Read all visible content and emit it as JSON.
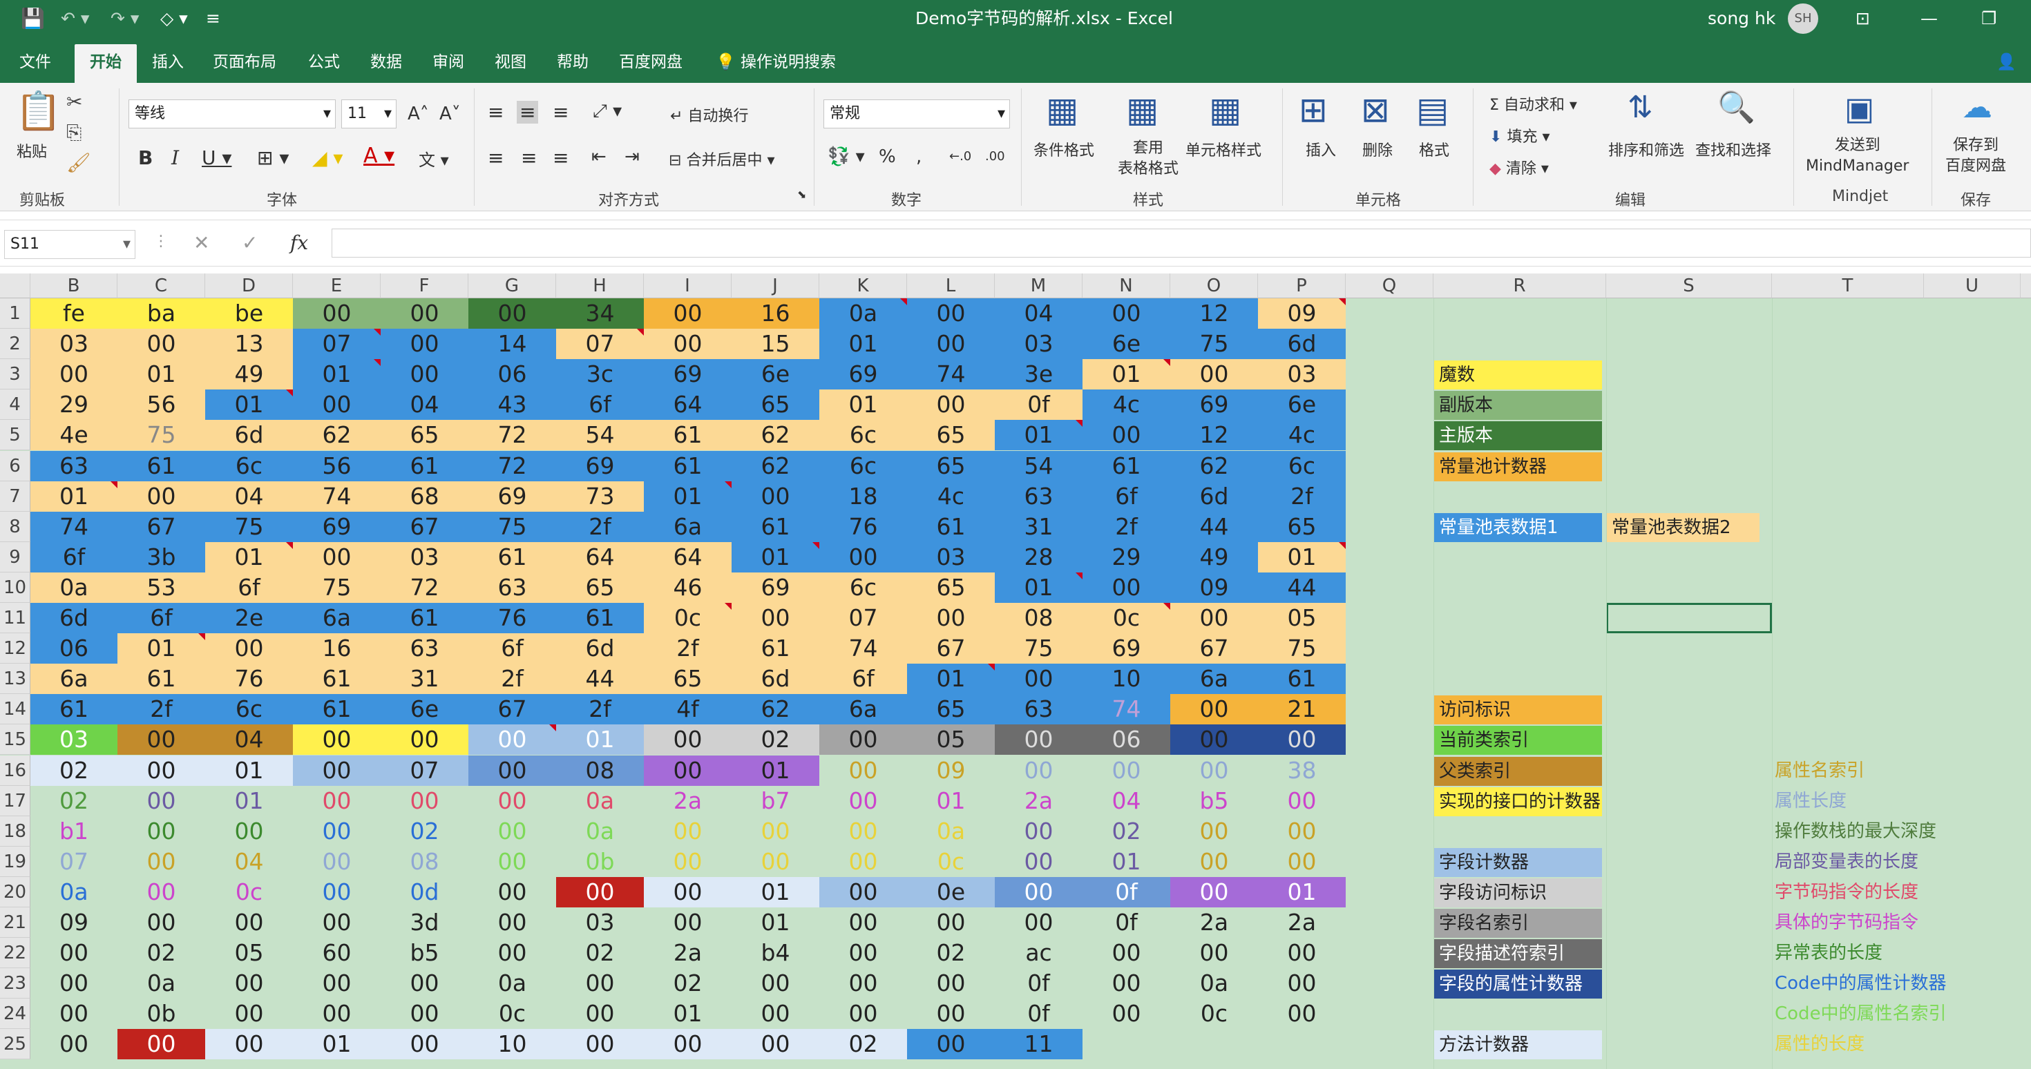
{
  "window": {
    "title": "Demo字节码的解析.xlsx  -  Excel",
    "user": "song hk",
    "user_initials": "SH"
  },
  "tabs": [
    "文件",
    "开始",
    "插入",
    "页面布局",
    "公式",
    "数据",
    "审阅",
    "视图",
    "帮助",
    "百度网盘",
    "操作说明搜索"
  ],
  "ribbon": {
    "paste": "粘贴",
    "clipboard": "剪贴板",
    "font_name": "等线",
    "font_size": "11",
    "font_group": "字体",
    "wrap": "自动换行",
    "merge": "合并后居中",
    "align_group": "对齐方式",
    "number_format": "常规",
    "number_group": "数字",
    "cond_format": "条件格式",
    "table_format": "套用\n表格格式",
    "cell_style": "单元格样式",
    "styles_group": "样式",
    "insert": "插入",
    "delete": "删除",
    "format": "格式",
    "cells_group": "单元格",
    "autosum": "自动求和",
    "fill": "填充",
    "clear": "清除",
    "sort": "排序和筛选",
    "find": "查找和选择",
    "edit_group": "编辑",
    "mindmanager": "发送到\nMindManager",
    "mindjet": "Mindjet",
    "baidu_save": "保存到\n百度网盘",
    "save_group": "保存"
  },
  "formula_bar": {
    "name_box": "S11",
    "fx": "fx",
    "content": ""
  },
  "columns": [
    "B",
    "C",
    "D",
    "E",
    "F",
    "G",
    "H",
    "I",
    "J",
    "K",
    "L",
    "M",
    "N",
    "O",
    "P",
    "Q",
    "R",
    "S",
    "T",
    "U",
    "V"
  ],
  "rows": [
    "1",
    "2",
    "3",
    "4",
    "5",
    "6",
    "7",
    "8",
    "9",
    "10",
    "11",
    "12",
    "13",
    "14",
    "15",
    "16",
    "17",
    "18",
    "19",
    "20",
    "21",
    "22",
    "23",
    "24",
    "25"
  ],
  "cells": [
    [
      "fe",
      "ba",
      "be",
      "00",
      "00",
      "00",
      "34",
      "00",
      "16",
      "0a",
      "00",
      "04",
      "00",
      "12",
      "09"
    ],
    [
      "03",
      "00",
      "13",
      "07",
      "00",
      "14",
      "07",
      "00",
      "15",
      "01",
      "00",
      "03",
      "6e",
      "75",
      "6d"
    ],
    [
      "00",
      "01",
      "49",
      "01",
      "00",
      "06",
      "3c",
      "69",
      "6e",
      "69",
      "74",
      "3e",
      "01",
      "00",
      "03"
    ],
    [
      "29",
      "56",
      "01",
      "00",
      "04",
      "43",
      "6f",
      "64",
      "65",
      "01",
      "00",
      "0f",
      "4c",
      "69",
      "6e"
    ],
    [
      "4e",
      "75",
      "6d",
      "62",
      "65",
      "72",
      "54",
      "61",
      "62",
      "6c",
      "65",
      "01",
      "00",
      "12",
      "4c"
    ],
    [
      "63",
      "61",
      "6c",
      "56",
      "61",
      "72",
      "69",
      "61",
      "62",
      "6c",
      "65",
      "54",
      "61",
      "62",
      "6c"
    ],
    [
      "01",
      "00",
      "04",
      "74",
      "68",
      "69",
      "73",
      "01",
      "00",
      "18",
      "4c",
      "63",
      "6f",
      "6d",
      "2f"
    ],
    [
      "74",
      "67",
      "75",
      "69",
      "67",
      "75",
      "2f",
      "6a",
      "61",
      "76",
      "61",
      "31",
      "2f",
      "44",
      "65"
    ],
    [
      "6f",
      "3b",
      "01",
      "00",
      "03",
      "61",
      "64",
      "64",
      "01",
      "00",
      "03",
      "28",
      "29",
      "49",
      "01"
    ],
    [
      "0a",
      "53",
      "6f",
      "75",
      "72",
      "63",
      "65",
      "46",
      "69",
      "6c",
      "65",
      "01",
      "00",
      "09",
      "44"
    ],
    [
      "6d",
      "6f",
      "2e",
      "6a",
      "61",
      "76",
      "61",
      "0c",
      "00",
      "07",
      "00",
      "08",
      "0c",
      "00",
      "05"
    ],
    [
      "06",
      "01",
      "00",
      "16",
      "63",
      "6f",
      "6d",
      "2f",
      "61",
      "74",
      "67",
      "75",
      "69",
      "67",
      "75"
    ],
    [
      "6a",
      "61",
      "76",
      "61",
      "31",
      "2f",
      "44",
      "65",
      "6d",
      "6f",
      "01",
      "00",
      "10",
      "6a",
      "61"
    ],
    [
      "61",
      "2f",
      "6c",
      "61",
      "6e",
      "67",
      "2f",
      "4f",
      "62",
      "6a",
      "65",
      "63",
      "74",
      "00",
      "21"
    ],
    [
      "03",
      "00",
      "04",
      "00",
      "00",
      "00",
      "01",
      "00",
      "02",
      "00",
      "05",
      "00",
      "06",
      "00",
      "00"
    ],
    [
      "02",
      "00",
      "01",
      "00",
      "07",
      "00",
      "08",
      "00",
      "01",
      "00",
      "09",
      "00",
      "00",
      "00",
      "38"
    ],
    [
      "02",
      "00",
      "01",
      "00",
      "00",
      "00",
      "0a",
      "2a",
      "b7",
      "00",
      "01",
      "2a",
      "04",
      "b5",
      "00"
    ],
    [
      "b1",
      "00",
      "00",
      "00",
      "02",
      "00",
      "0a",
      "00",
      "00",
      "00",
      "0a",
      "00",
      "02",
      "00",
      "00"
    ],
    [
      "07",
      "00",
      "04",
      "00",
      "08",
      "00",
      "0b",
      "00",
      "00",
      "00",
      "0c",
      "00",
      "01",
      "00",
      "00"
    ],
    [
      "0a",
      "00",
      "0c",
      "00",
      "0d",
      "00",
      "00",
      "00",
      "01",
      "00",
      "0e",
      "00",
      "0f",
      "00",
      "01"
    ],
    [
      "09",
      "00",
      "00",
      "00",
      "3d",
      "00",
      "03",
      "00",
      "01",
      "00",
      "00",
      "00",
      "0f",
      "2a",
      "2a"
    ],
    [
      "00",
      "02",
      "05",
      "60",
      "b5",
      "00",
      "02",
      "2a",
      "b4",
      "00",
      "02",
      "ac",
      "00",
      "00",
      "00"
    ],
    [
      "00",
      "0a",
      "00",
      "00",
      "00",
      "0a",
      "00",
      "02",
      "00",
      "00",
      "00",
      "0f",
      "00",
      "0a",
      "00"
    ],
    [
      "00",
      "0b",
      "00",
      "00",
      "00",
      "0c",
      "00",
      "01",
      "00",
      "00",
      "00",
      "0f",
      "00",
      "0c",
      "00"
    ],
    [
      "00",
      "00",
      "00",
      "01",
      "00",
      "10",
      "00",
      "00",
      "00",
      "02",
      "00",
      "11",
      "",
      "",
      ""
    ]
  ],
  "legend_r": [
    {
      "row": 3,
      "text": "魔数",
      "bg": "#fff04d"
    },
    {
      "row": 4,
      "text": "副版本",
      "bg": "#87b67a"
    },
    {
      "row": 5,
      "text": "主版本",
      "bg": "#3e7e3a"
    },
    {
      "row": 6,
      "text": "常量池计数器",
      "bg": "#f5b43b"
    },
    {
      "row": 8,
      "text": "常量池表数据1",
      "bg": "#3e93dd"
    },
    {
      "row": 14,
      "text": "访问标识",
      "bg": "#f5b43b"
    },
    {
      "row": 15,
      "text": "当前类索引",
      "bg": "#6fd34a"
    },
    {
      "row": 16,
      "text": "父类索引",
      "bg": "#c28b2c"
    },
    {
      "row": 17,
      "text": "实现的接口的计数器",
      "bg": "#fff04d"
    },
    {
      "row": 19,
      "text": "字段计数器",
      "bg": "#9fc1e6"
    },
    {
      "row": 20,
      "text": "字段访问标识",
      "bg": "#d0d0d0"
    },
    {
      "row": 21,
      "text": "字段名索引",
      "bg": "#a4a4a4"
    },
    {
      "row": 22,
      "text": "字段描述符索引",
      "bg": "#6d6d6d"
    },
    {
      "row": 23,
      "text": "字段的属性计数器",
      "bg": "#2a4f99"
    },
    {
      "row": 25,
      "text": "方法计数器",
      "bg": "#dde9f7"
    }
  ],
  "legend_s": {
    "row": 8,
    "text": "常量池表数据2",
    "bg": "#fcd995"
  },
  "notes_t": [
    {
      "row": 16,
      "text": "属性名索引",
      "color": "#c9a227"
    },
    {
      "row": 17,
      "text": "属性长度",
      "color": "#8fa7d4"
    },
    {
      "row": 18,
      "text": "操作数栈的最大深度",
      "color": "#4f7c3d"
    },
    {
      "row": 19,
      "text": "局部变量表的长度",
      "color": "#6b5aa3"
    },
    {
      "row": 20,
      "text": "字节码指令的长度",
      "color": "#e04a6a"
    },
    {
      "row": 21,
      "text": "具体的字节码指令",
      "color": "#cc44cc"
    },
    {
      "row": 22,
      "text": "异常表的长度",
      "color": "#3c8a2e"
    },
    {
      "row": 23,
      "text": "Code中的属性计数器",
      "color": "#2a6fd6"
    },
    {
      "row": 24,
      "text": "Code中的属性名索引",
      "color": "#7ed957"
    },
    {
      "row": 25,
      "text": "属性的长度",
      "color": "#e8d23a"
    }
  ],
  "colors": {
    "title_green": "#217346",
    "sheet_bg": "#c7e2c9",
    "yellow": "#fff04d",
    "light_orange": "#fcd995",
    "orange": "#f5b43b",
    "blue": "#3e93dd",
    "green_light": "#87b67a",
    "green_dark": "#3e7e3a",
    "red": "#c1231d"
  }
}
